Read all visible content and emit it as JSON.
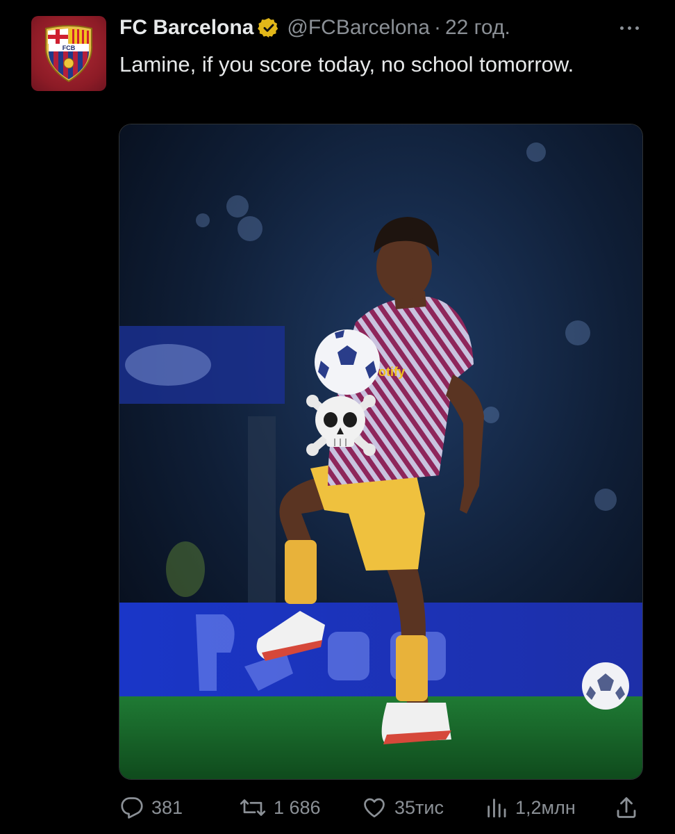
{
  "tweet": {
    "author": {
      "display_name": "FC Barcelona",
      "handle": "@FCBarcelona",
      "verified_icon": "verified-badge-icon",
      "avatar_icon": "fc-barcelona-crest",
      "avatar_text": "FCB"
    },
    "separator": "·",
    "time": "22 год.",
    "text": "Lamine, if you score today, no school tomorrow.",
    "media": {
      "type": "photo",
      "alt": "",
      "overlay_emoji": "☠️"
    },
    "actions": {
      "replies": "381",
      "reposts": "1 686",
      "likes": "35тис",
      "views": "1,2млн"
    }
  },
  "colors": {
    "background": "#000000",
    "primary_text": "#e7e9ea",
    "secondary_text": "#8b9096",
    "verified_gold": "#e2b719",
    "avatar_red": "#9b2230"
  }
}
